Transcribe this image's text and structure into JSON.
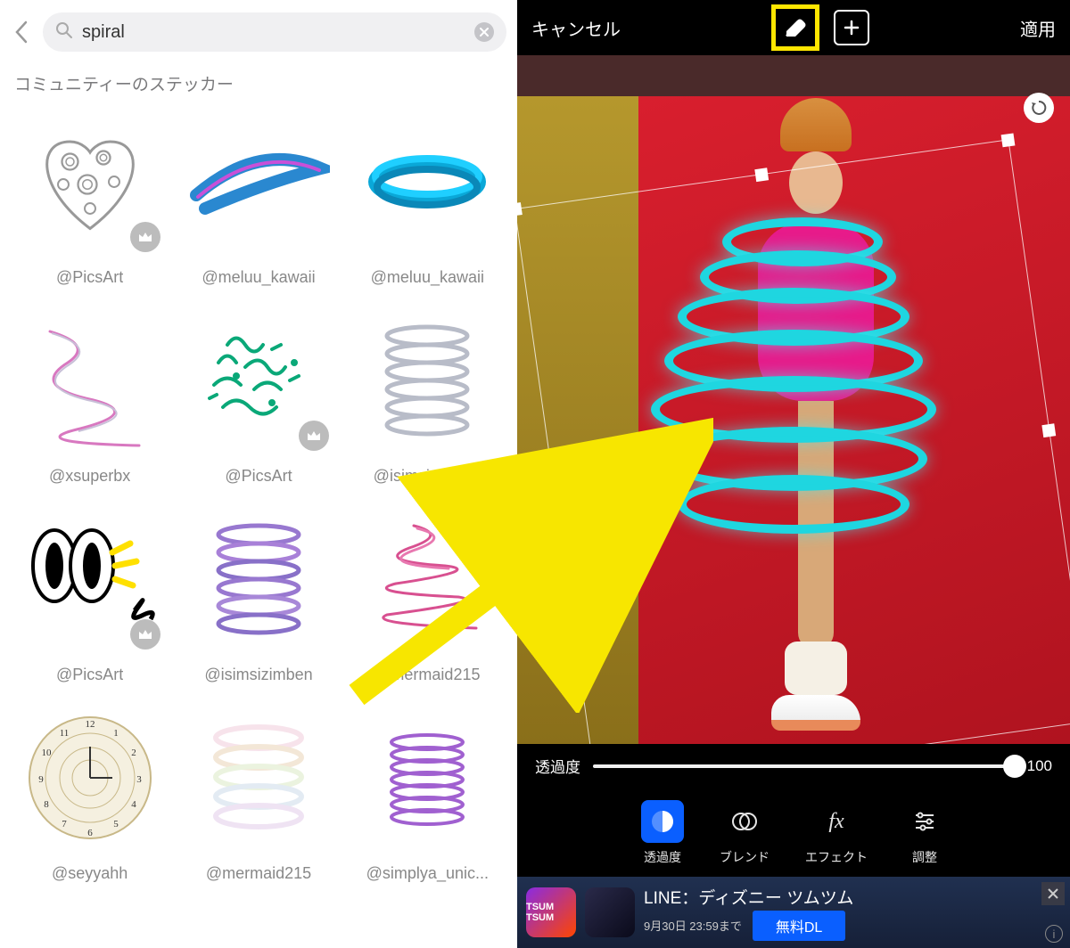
{
  "search": {
    "value": "spiral",
    "placeholder": ""
  },
  "section_title": "コミュニティーのステッカー",
  "stickers": [
    {
      "author": "@PicsArt",
      "premium": true
    },
    {
      "author": "@meluu_kawaii",
      "premium": false
    },
    {
      "author": "@meluu_kawaii",
      "premium": false
    },
    {
      "author": "@xsuperbx",
      "premium": false
    },
    {
      "author": "@PicsArt",
      "premium": true
    },
    {
      "author": "@isimsizimben",
      "premium": false
    },
    {
      "author": "@PicsArt",
      "premium": true
    },
    {
      "author": "@isimsizimben",
      "premium": false
    },
    {
      "author": "@mermaid215",
      "premium": false
    },
    {
      "author": "@seyyahh",
      "premium": false
    },
    {
      "author": "@mermaid215",
      "premium": false
    },
    {
      "author": "@simplya_unic...",
      "premium": false
    }
  ],
  "editor": {
    "cancel": "キャンセル",
    "apply": "適用",
    "opacity_label": "透過度",
    "opacity_value": "100",
    "tools": {
      "opacity": "透過度",
      "blend": "ブレンド",
      "effect": "エフェクト",
      "adjust": "調整"
    }
  },
  "ad": {
    "title": "LINE：ディズニー ツムツム",
    "date": "9月30日 23:59まで",
    "dl_button": "無料DL",
    "icon_text": "TSUM TSUM"
  }
}
